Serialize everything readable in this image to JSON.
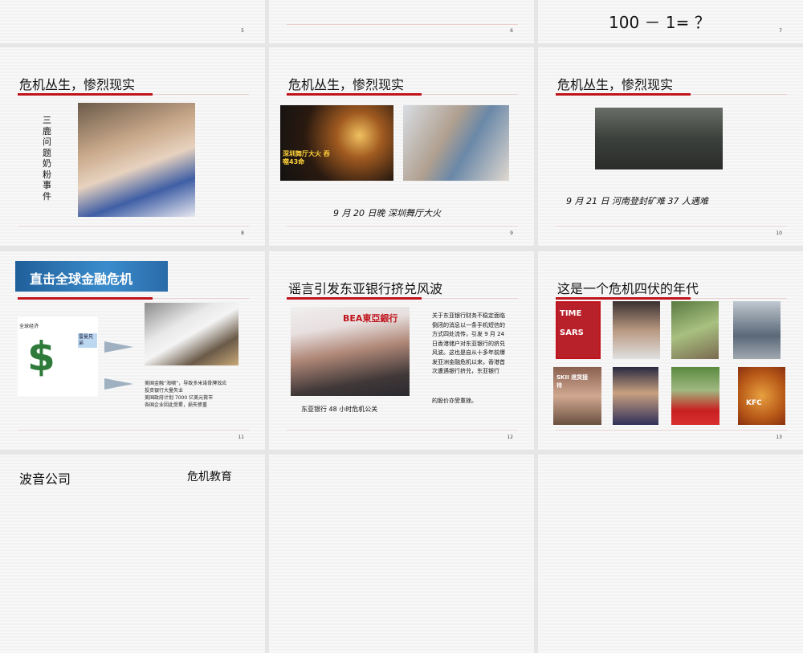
{
  "slides": [
    {
      "number": "5"
    },
    {
      "number": "6"
    },
    {
      "number": "7",
      "text": "100 － 1= ？"
    },
    {
      "number": "8",
      "title": "危机丛生，惨烈现实",
      "vertical_text": "三鹿问题奶粉事件"
    },
    {
      "number": "9",
      "title": "危机丛生，惨烈现实",
      "caption": "9 月 20 日晚  深圳舞厅大火",
      "image_text": "深圳舞厅大火 吞噬43命"
    },
    {
      "number": "10",
      "title": "危机丛生，惨烈现实",
      "caption": "9 月 21 日   河南登封矿难      37 人遇难"
    },
    {
      "number": "11",
      "banner": "直击全球金融危机",
      "cartoon_labels": [
        "全球经济",
        "雷曼兄弟"
      ],
      "text_lines": [
        "美国金融“海啸”，导致多米诺骨牌效应",
        "投资银行大量失业",
        "美国政府计划 7000 亿美元救市",
        "各国企业因此受累，损失惨重"
      ]
    },
    {
      "number": "12",
      "title": "谣言引发东亚银行挤兑风波",
      "caption": "东亚银行 48 小时危机公关",
      "paragraph": "关于东亚银行财务不稳定面临倒闭的消息以一条手机短信的方式四处流传，引发 9 月 24 日香港储户对东亚银行的挤兑风波。这也是自从十多年前爆发亚洲金融危机以来，香港首次遭遇银行挤兑，东亚银行",
      "paragraph_end": "的股价亦受重挫。",
      "image_text": "BEA東亞銀行"
    },
    {
      "number": "13",
      "title": "这是一个危机四伏的年代",
      "image_labels": [
        "TIME SARS",
        "SKII 退货接待",
        "KFC"
      ]
    },
    {
      "title": "波音公司",
      "subtitle": "危机教育"
    },
    {},
    {}
  ]
}
